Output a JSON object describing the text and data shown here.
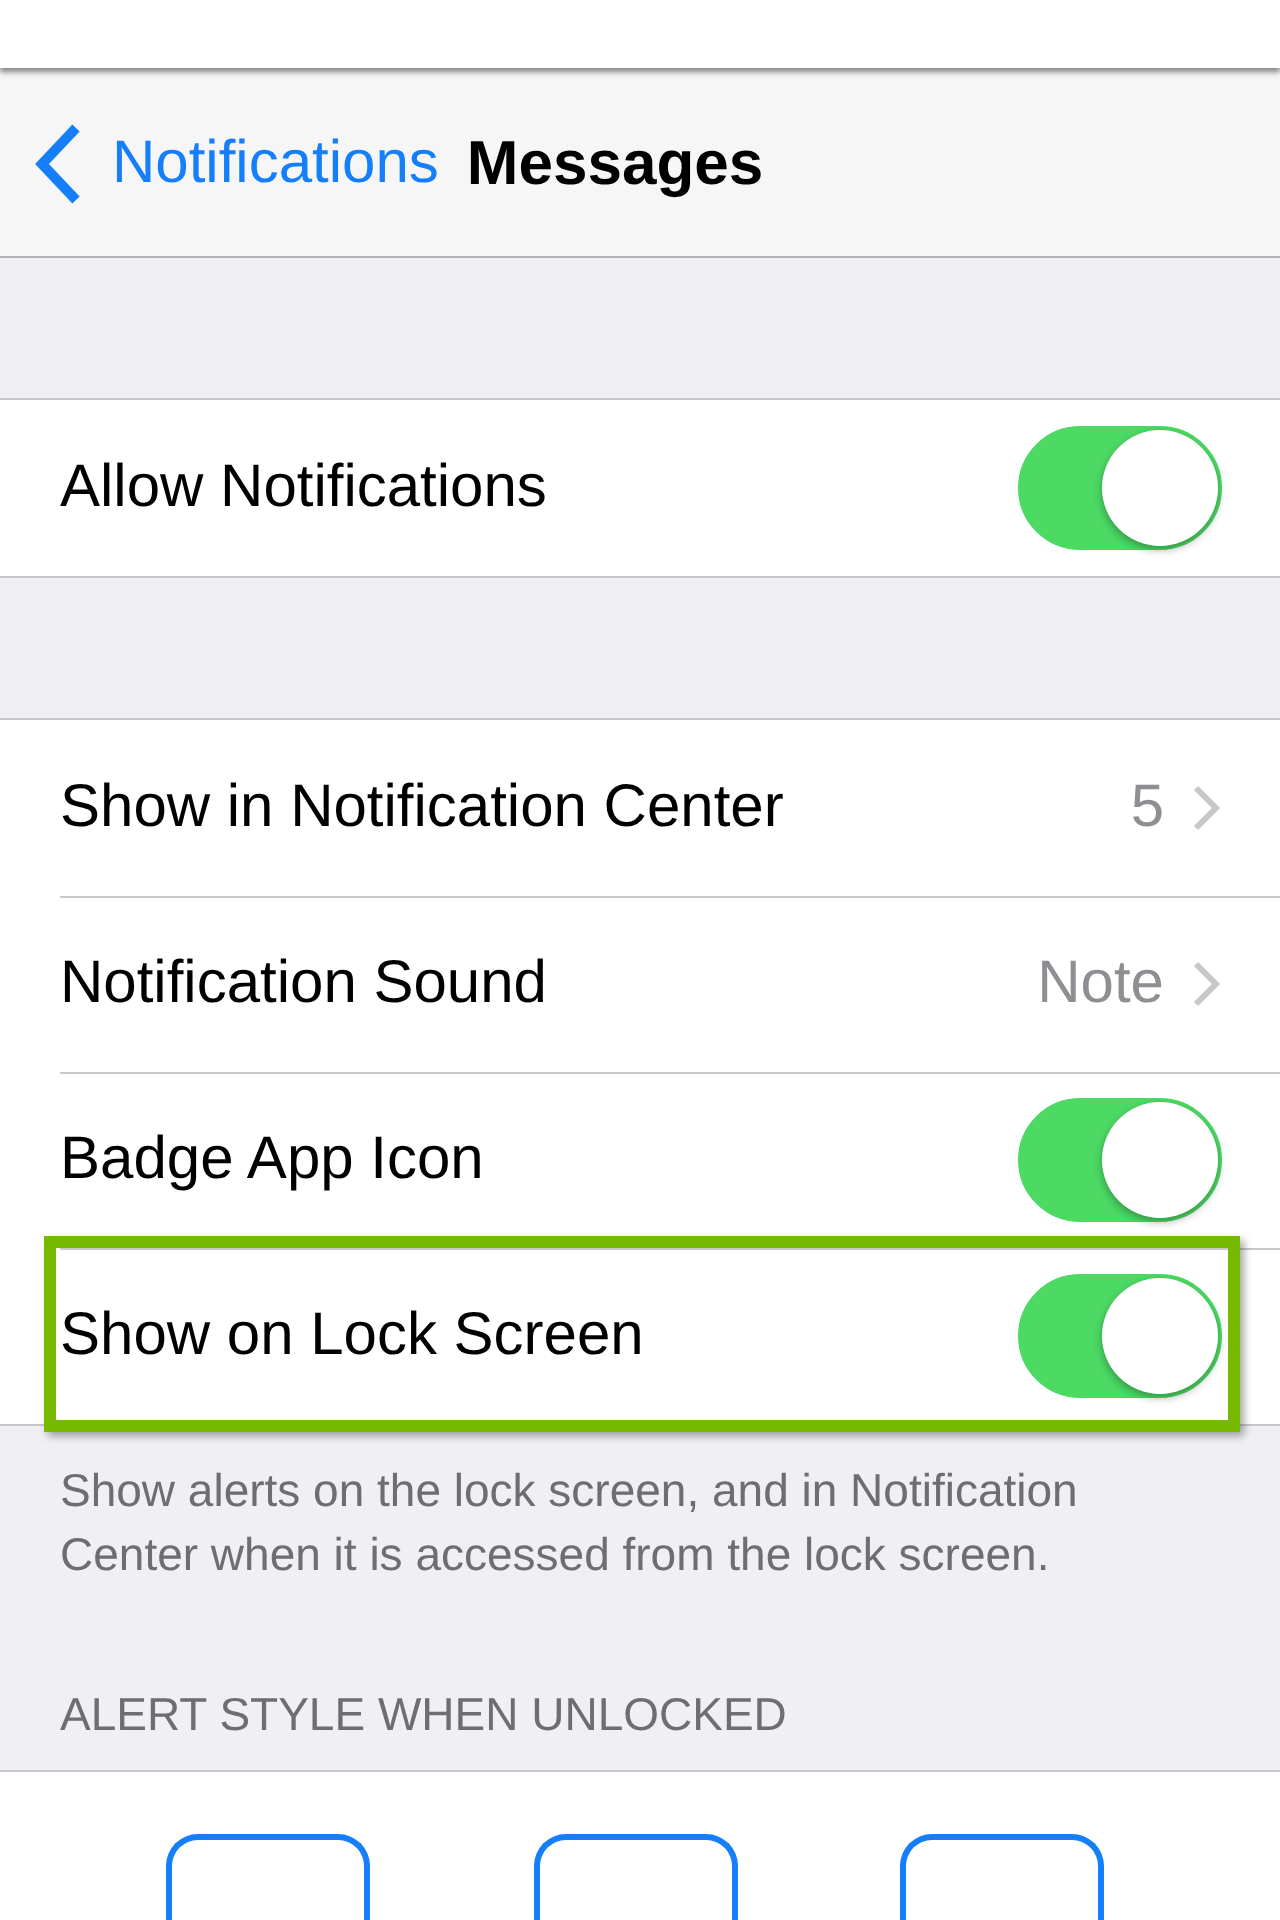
{
  "nav": {
    "back_label": "Notifications",
    "title": "Messages"
  },
  "groups": [
    {
      "rows": [
        {
          "kind": "toggle",
          "label": "Allow Notifications",
          "on": true,
          "highlighted": false
        }
      ]
    },
    {
      "rows": [
        {
          "kind": "detail",
          "label": "Show in Notification Center",
          "value": "5",
          "highlighted": false
        },
        {
          "kind": "detail",
          "label": "Notification Sound",
          "value": "Note",
          "highlighted": false
        },
        {
          "kind": "toggle",
          "label": "Badge App Icon",
          "on": true,
          "highlighted": false
        },
        {
          "kind": "toggle",
          "label": "Show on Lock Screen",
          "on": true,
          "highlighted": true
        }
      ],
      "footer": "Show alerts on the lock screen, and in Notification Center when it is accessed from the lock screen."
    }
  ],
  "alert_section": {
    "header": "ALERT STYLE WHEN UNLOCKED"
  }
}
